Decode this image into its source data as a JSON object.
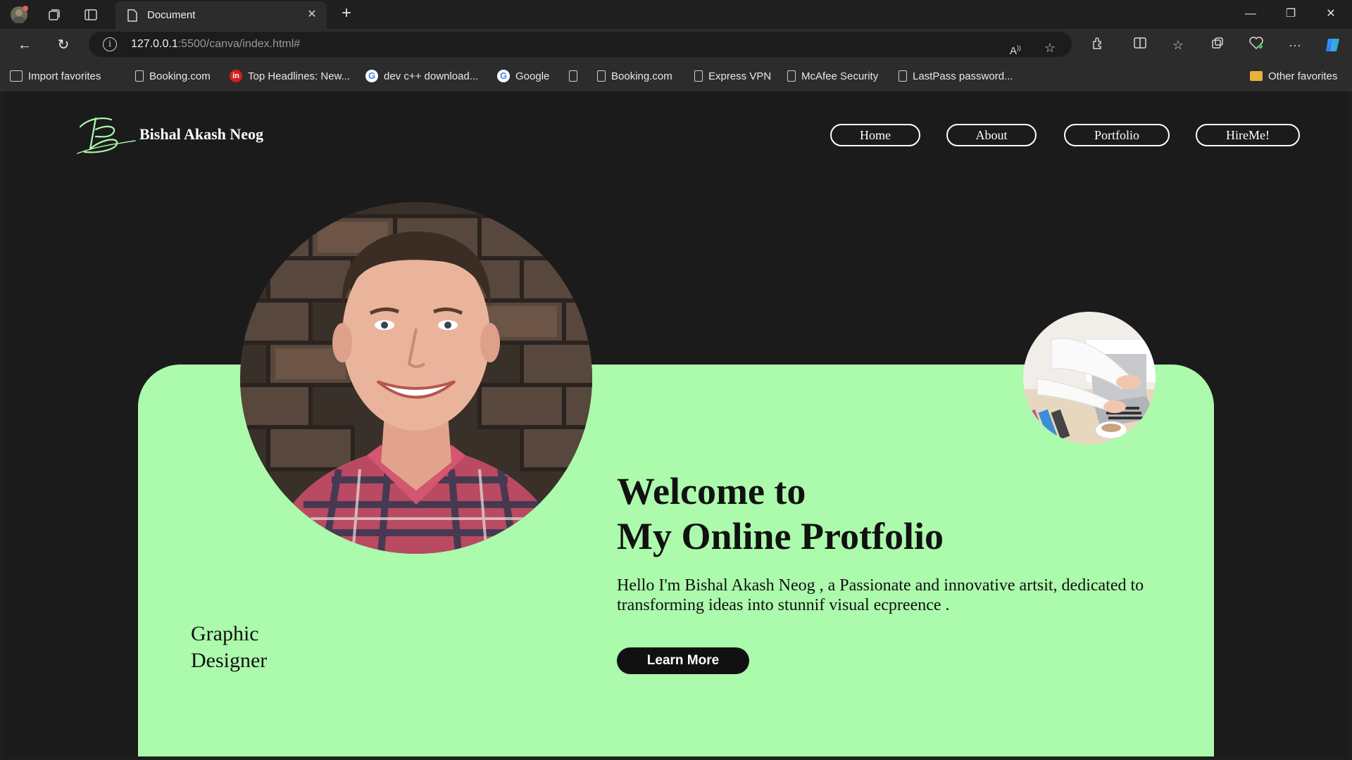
{
  "browser": {
    "tab_title": "Document",
    "url_host": "127.0.0.1",
    "url_rest": ":5500/canva/index.html#",
    "icons": [
      "avatar-icon",
      "workspaces-icon",
      "tab-actions-icon",
      "document-icon",
      "close-icon",
      "plus-icon",
      "back-icon",
      "refresh-icon",
      "info-icon",
      "read-aloud-icon",
      "star-icon",
      "extensions-icon",
      "split-screen-icon",
      "favorites-icon",
      "collections-icon",
      "health-icon",
      "more-icon",
      "copilot-icon"
    ]
  },
  "favorites": [
    {
      "label": "Import favorites",
      "icon": "import-icon"
    },
    {
      "label": "Booking.com",
      "icon": "page-icon"
    },
    {
      "label": "Top Headlines: New...",
      "icon": "news-icon"
    },
    {
      "label": "dev c++ download...",
      "icon": "google-icon"
    },
    {
      "label": "Google",
      "icon": "google-icon"
    },
    {
      "label": "",
      "icon": "page-icon"
    },
    {
      "label": "Booking.com",
      "icon": "page-icon"
    },
    {
      "label": "Express VPN",
      "icon": "page-icon"
    },
    {
      "label": "McAfee Security",
      "icon": "page-icon"
    },
    {
      "label": "LastPass password...",
      "icon": "page-icon"
    },
    {
      "label": "Other favorites",
      "icon": "folder-icon"
    }
  ],
  "site": {
    "name": "Bishal Akash Neog",
    "nav": [
      "Home",
      "About",
      "Portfolio",
      "HireMe!"
    ],
    "accent": "#acfaac",
    "background": "#1b1b1b"
  },
  "hero": {
    "welcome_line1": "Welcome to",
    "welcome_line2": "My Online Protfolio",
    "intro": "Hello I'm Bishal Akash Neog , a Passionate and innovative artsit, dedicated to transforming ideas into stunnif visual ecpreence .",
    "cta_label": "Learn More",
    "role_line1": "Graphic",
    "role_line2": "Designer"
  }
}
